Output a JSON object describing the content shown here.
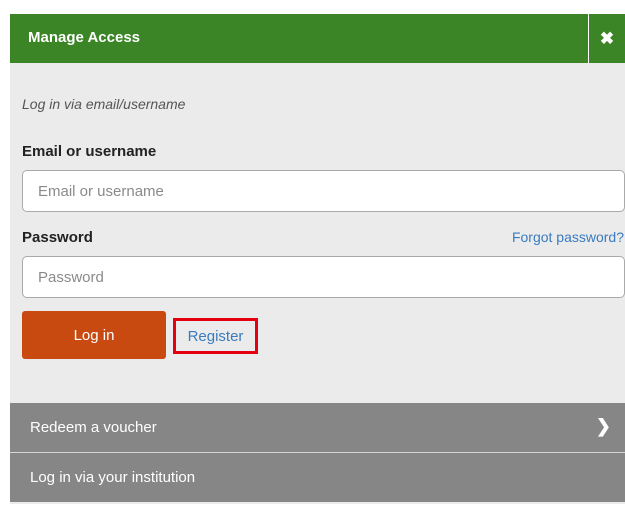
{
  "header": {
    "title": "Manage Access",
    "close_symbol": "✖"
  },
  "form": {
    "subtitle": "Log in via email/username",
    "email_label": "Email or username",
    "email_placeholder": "Email or username",
    "email_value": "",
    "password_label": "Password",
    "password_placeholder": "Password",
    "password_value": "",
    "forgot_label": "Forgot password?",
    "login_label": "Log in",
    "register_label": "Register"
  },
  "options": {
    "voucher_label": "Redeem a voucher",
    "voucher_chevron": "❯",
    "institution_label": "Log in via your institution"
  },
  "colors": {
    "header_green": "#3b8526",
    "login_button": "#c84a10",
    "link_blue": "#3a7bbf",
    "highlight_red": "#e3000f",
    "option_row": "#868686",
    "panel_bg": "#ebebeb"
  },
  "icons": {
    "close": "close-icon",
    "voucher_arrow": "chevron-right-icon"
  }
}
